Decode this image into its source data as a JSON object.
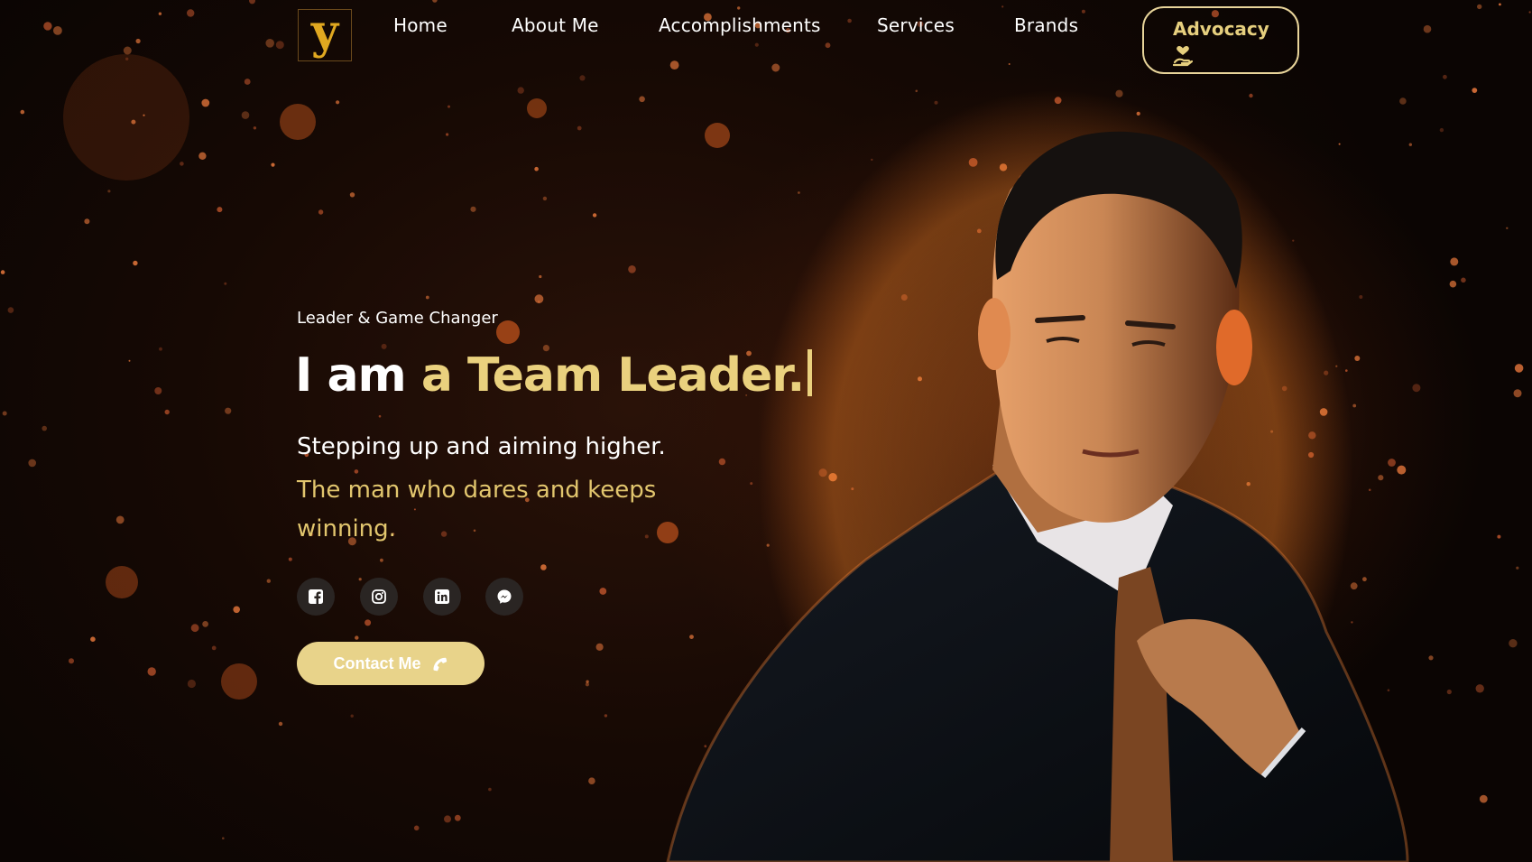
{
  "logo": {
    "glyph": "y"
  },
  "nav": {
    "items": [
      {
        "label": "Home"
      },
      {
        "label": "About Me"
      },
      {
        "label": "Accomplishments"
      },
      {
        "label": "Services"
      },
      {
        "label": "Brands"
      }
    ],
    "cta": {
      "label": "Advocacy",
      "icon": "hand-heart-icon"
    }
  },
  "hero": {
    "eyebrow": "Leader & Game Changer",
    "headline_prefix": "I am",
    "headline_typed": "a Team Leader.",
    "line1": "Stepping up and aiming higher.",
    "line2": "The man who dares and keeps winning."
  },
  "social": [
    {
      "icon": "facebook-icon"
    },
    {
      "icon": "instagram-icon"
    },
    {
      "icon": "linkedin-icon"
    },
    {
      "icon": "messenger-icon"
    }
  ],
  "contact_button": {
    "label": "Contact Me",
    "icon": "phone-icon"
  },
  "colors": {
    "accent_gold": "#ead17e",
    "button_gold": "#e8d38a",
    "background_dark": "#160904",
    "ember_orange": "#c0531c"
  }
}
